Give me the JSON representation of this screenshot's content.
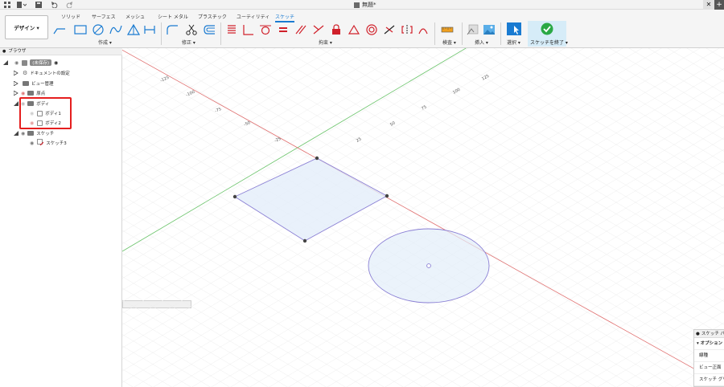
{
  "window": {
    "document_title": "無題*"
  },
  "ribbon": {
    "workspace_label": "デザイン ▾",
    "tabs": [
      "ソリッド",
      "サーフェス",
      "メッシュ",
      "シート メタル",
      "プラスチック",
      "ユーティリティ",
      "スケッチ"
    ],
    "active_tab": "スケッチ",
    "groups": {
      "create": "作成 ▾",
      "modify": "修正 ▾",
      "constraints": "拘束 ▾",
      "inspect": "検査 ▾",
      "insert": "挿入 ▾",
      "select": "選択 ▾",
      "finish": "スケッチを終了 ▾"
    },
    "colors": {
      "accent": "#1a7bd1",
      "finish_bg": "#d6ecf8",
      "finish_check": "#2aa845",
      "constraint_red": "#d0202a"
    }
  },
  "browser": {
    "title": "ブラウザ",
    "root_label": "(未保存)",
    "items": [
      {
        "label": "ドキュメントの設定",
        "icon": "gear-icon"
      },
      {
        "label": "ビュー管理",
        "icon": "folder-icon"
      },
      {
        "label": "原点",
        "icon": "folder-icon"
      },
      {
        "label": "ボディ",
        "icon": "folder-icon"
      },
      {
        "label": "ボディ1",
        "icon": "body-icon"
      },
      {
        "label": "ボディ2",
        "icon": "body-icon"
      },
      {
        "label": "スケッチ",
        "icon": "folder-icon"
      },
      {
        "label": "スケッチ3",
        "icon": "sketch-icon"
      }
    ],
    "highlight_color": "#e51e1e"
  },
  "canvas": {
    "ruler_labels_left": [
      "-125",
      "-100",
      "-75",
      "-50",
      "-25"
    ],
    "ruler_labels_right": [
      "125",
      "100",
      "75",
      "50",
      "25"
    ],
    "axis_colors": {
      "x": "#e05555",
      "y": "#55c055",
      "sketch": "#8a7fd4",
      "fill": "#e3eefa"
    }
  },
  "palette": {
    "title": "スケッチ パレ",
    "section": "▾ オプション",
    "rows": [
      "線種",
      "ビュー正面",
      "スケッチ グリッド"
    ]
  }
}
